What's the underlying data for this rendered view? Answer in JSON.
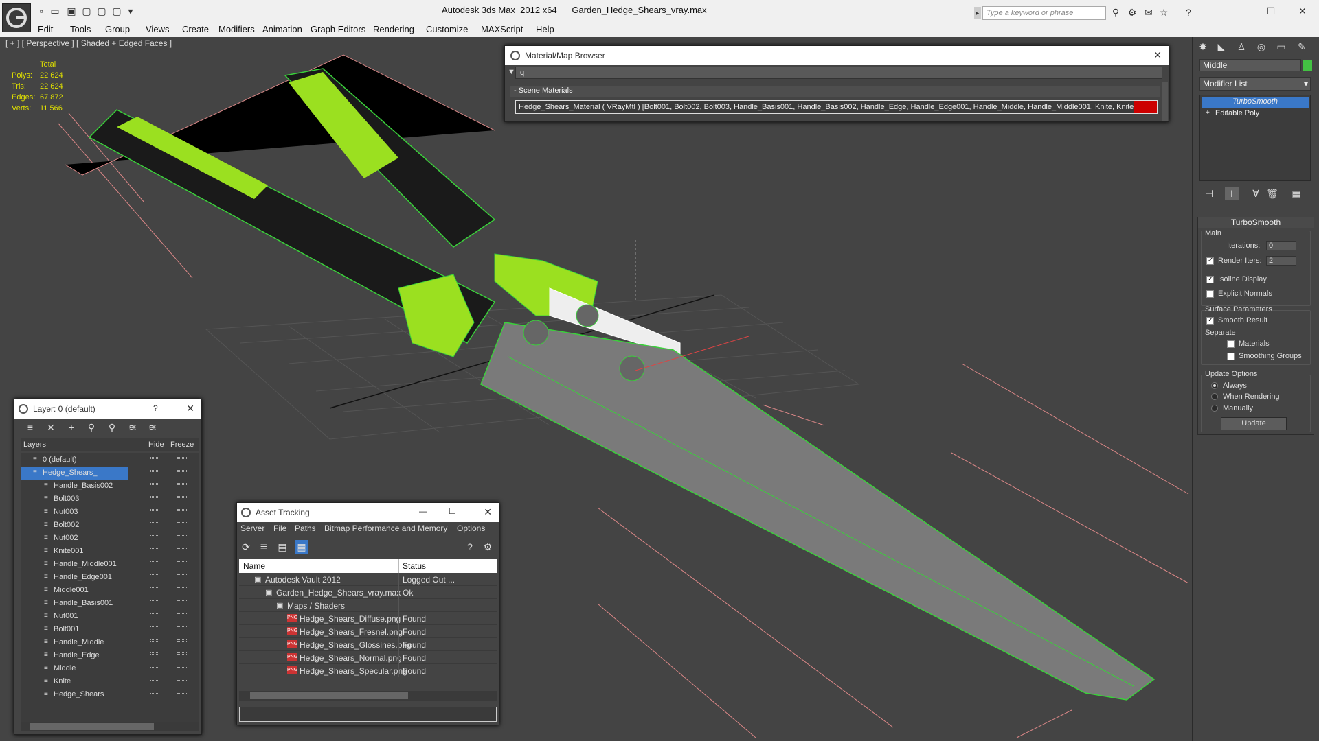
{
  "title": {
    "app": "Autodesk 3ds Max  2012 x64",
    "file": "Garden_Hedge_Shears_vray.max"
  },
  "search": {
    "placeholder": "Type a keyword or phrase"
  },
  "menu": [
    "Edit",
    "Tools",
    "Group",
    "Views",
    "Create",
    "Modifiers",
    "Animation",
    "Graph Editors",
    "Rendering",
    "Customize",
    "MAXScript",
    "Help"
  ],
  "viewport": {
    "label": "[ + ] [ Perspective ] [ Shaded + Edged Faces ]",
    "stats": {
      "total": "Total",
      "polys_label": "Polys:",
      "polys": "22 624",
      "tris_label": "Tris:",
      "tris": "22 624",
      "edges_label": "Edges:",
      "edges": "67 872",
      "verts_label": "Verts:",
      "verts": "11 566"
    }
  },
  "command_panel": {
    "object_name": "Middle",
    "object_color": "#43c243",
    "modifier_list": "Modifier List",
    "stack": [
      "TurboSmooth",
      "Editable Poly"
    ],
    "turbosmooth": {
      "title": "TurboSmooth",
      "main": "Main",
      "iterations_label": "Iterations:",
      "iterations": "0",
      "render_iters_label": "Render Iters:",
      "render_iters": "2",
      "isoline": "Isoline Display",
      "explicit_normals": "Explicit Normals",
      "surface_params": "Surface Parameters",
      "smooth_result": "Smooth Result",
      "separate": "Separate",
      "materials": "Materials",
      "smoothing_groups": "Smoothing Groups",
      "update_options": "Update Options",
      "always": "Always",
      "when_rendering": "When Rendering",
      "manually": "Manually",
      "update_button": "Update"
    }
  },
  "material_browser": {
    "title": "Material/Map Browser",
    "search_value": "q",
    "section": "Scene Materials",
    "item": "Hedge_Shears_Material  ( VRayMtl ) [Bolt001, Bolt002, Bolt003, Handle_Basis001, Handle_Basis002, Handle_Edge, Handle_Edge001, Handle_Middle, Handle_Middle001, Knite, Knite0..."
  },
  "layer_dialog": {
    "title": "Layer: 0 (default)",
    "help": "?",
    "col_layers": "Layers",
    "col_hide": "Hide",
    "col_freeze": "Freeze",
    "layers": [
      {
        "name": "0 (default)",
        "level": 0
      },
      {
        "name": "Hedge_Shears_",
        "level": 0,
        "selected": true
      },
      {
        "name": "Handle_Basis002",
        "level": 1
      },
      {
        "name": "Bolt003",
        "level": 1
      },
      {
        "name": "Nut003",
        "level": 1
      },
      {
        "name": "Bolt002",
        "level": 1
      },
      {
        "name": "Nut002",
        "level": 1
      },
      {
        "name": "Knite001",
        "level": 1
      },
      {
        "name": "Handle_Middle001",
        "level": 1
      },
      {
        "name": "Handle_Edge001",
        "level": 1
      },
      {
        "name": "Middle001",
        "level": 1
      },
      {
        "name": "Handle_Basis001",
        "level": 1
      },
      {
        "name": "Nut001",
        "level": 1
      },
      {
        "name": "Bolt001",
        "level": 1
      },
      {
        "name": "Handle_Middle",
        "level": 1
      },
      {
        "name": "Handle_Edge",
        "level": 1
      },
      {
        "name": "Middle",
        "level": 1
      },
      {
        "name": "Knite",
        "level": 1
      },
      {
        "name": "Hedge_Shears",
        "level": 1
      }
    ]
  },
  "asset_tracking": {
    "title": "Asset Tracking",
    "menu": [
      "Server",
      "File",
      "Paths",
      "Bitmap Performance and Memory",
      "Options"
    ],
    "col_name": "Name",
    "col_status": "Status",
    "rows": [
      {
        "name": "Autodesk Vault 2012",
        "status": "Logged Out ...",
        "icon": "vault-icon"
      },
      {
        "name": "Garden_Hedge_Shears_vray.max",
        "status": "Ok",
        "icon": "max-file-icon"
      },
      {
        "name": "Maps / Shaders",
        "status": "",
        "icon": "maps-icon"
      },
      {
        "name": "Hedge_Shears_Diffuse.png",
        "status": "Found",
        "icon": "png-icon"
      },
      {
        "name": "Hedge_Shears_Fresnel.png",
        "status": "Found",
        "icon": "png-icon"
      },
      {
        "name": "Hedge_Shears_Glossines.png",
        "status": "Found",
        "icon": "png-icon"
      },
      {
        "name": "Hedge_Shears_Normal.png",
        "status": "Found",
        "icon": "png-icon"
      },
      {
        "name": "Hedge_Shears_Specular.png",
        "status": "Found",
        "icon": "png-icon"
      }
    ]
  }
}
